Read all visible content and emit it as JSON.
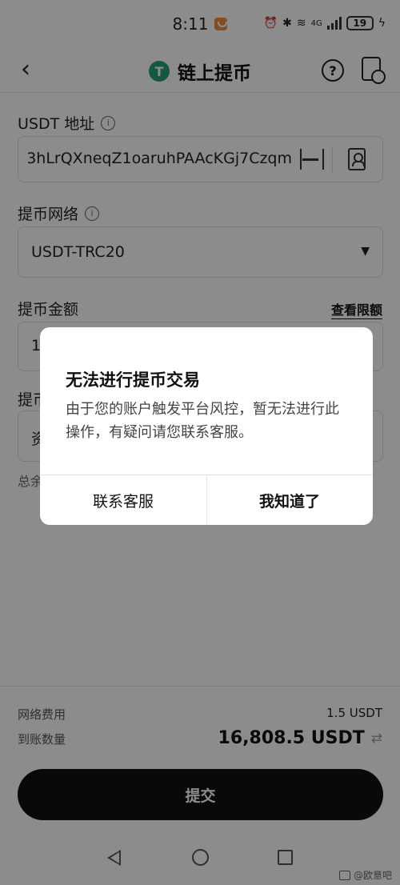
{
  "status_bar": {
    "time": "8:11",
    "battery": "19",
    "network": "4G"
  },
  "header": {
    "title": "链上提币",
    "token_icon": "T",
    "help_icon": "?"
  },
  "form": {
    "address_label": "USDT 地址",
    "address_value": "3hLrQXneqZ1oaruhPAAcKGj7Czqm",
    "network_label": "提币网络",
    "network_value": "USDT-TRC20",
    "amount_label": "提币金额",
    "view_limit_link": "查看限额",
    "amount_value_partial": "1",
    "row4_label_partial": "提币",
    "row4_value_partial": "资",
    "total_partial": "总余"
  },
  "summary": {
    "fee_label": "网络费用",
    "fee_value": "1.5 USDT",
    "receive_label": "到账数量",
    "receive_value": "16,808.5 USDT"
  },
  "submit_label": "提交",
  "dialog": {
    "title": "无法进行提币交易",
    "message": "由于您的账户触发平台风控，暂无法进行此操作，有疑问请您联系客服。",
    "contact_button": "联系客服",
    "ok_button": "我知道了"
  },
  "watermark": "@欧意吧",
  "colors": {
    "tether_green": "#26a17b",
    "submit_bg": "#111111",
    "overlay": "rgba(0,0,0,0.45)"
  },
  "icons": [
    "back-arrow-icon",
    "tether-icon",
    "help-icon",
    "history-icon",
    "info-icon",
    "scan-icon",
    "contact-book-icon",
    "caret-down-icon",
    "swap-icon",
    "nav-back-icon",
    "nav-home-icon",
    "nav-recent-icon"
  ]
}
